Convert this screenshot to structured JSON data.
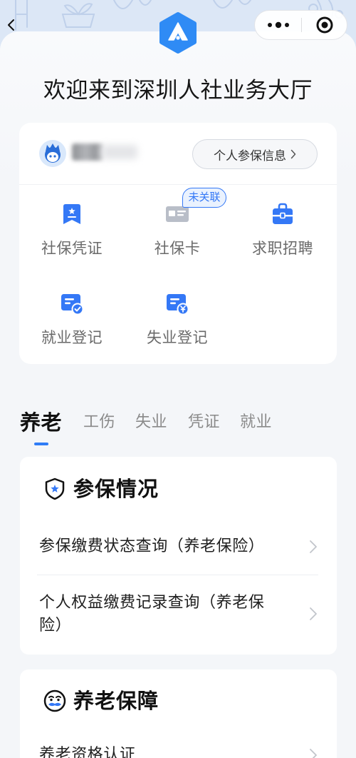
{
  "header": {
    "back_icon": "chevron-left-icon",
    "capsule": {
      "more_icon": "more-dots-icon",
      "close_icon": "target-circle-icon"
    },
    "logo_icon": "hexagon-logo-icon"
  },
  "page_title": "欢迎来到深圳人社业务大厅",
  "user_card": {
    "avatar_icon": "cartoon-avatar-icon",
    "profile_button": {
      "label": "个人参保信息",
      "icon": "chevron-right-icon"
    },
    "services": [
      {
        "label": "社保凭证",
        "icon": "certificate-icon"
      },
      {
        "label": "社保卡",
        "icon": "card-icon",
        "badge": "未关联"
      },
      {
        "label": "求职招聘",
        "icon": "briefcase-icon"
      },
      {
        "label": "就业登记",
        "icon": "document-check-icon"
      },
      {
        "label": "失业登记",
        "icon": "document-yen-icon"
      }
    ]
  },
  "tabs": {
    "active_index": 0,
    "items": [
      "养老",
      "工伤",
      "失业",
      "凭证",
      "就业"
    ]
  },
  "sections": [
    {
      "title": "参保情况",
      "icon": "shield-star-icon",
      "items": [
        "参保缴费状态查询（养老保险）",
        "个人权益缴费记录查询（养老保险）"
      ]
    },
    {
      "title": "养老保障",
      "icon": "elder-face-icon",
      "items": [
        "养老资格认证"
      ]
    }
  ],
  "theme": {
    "accent": "#3478f6",
    "background": "#f5f7fa",
    "card": "#ffffff",
    "text": "#1b1b1b",
    "muted": "#8a8a8a",
    "disabled_icon": "#b9bec8"
  }
}
